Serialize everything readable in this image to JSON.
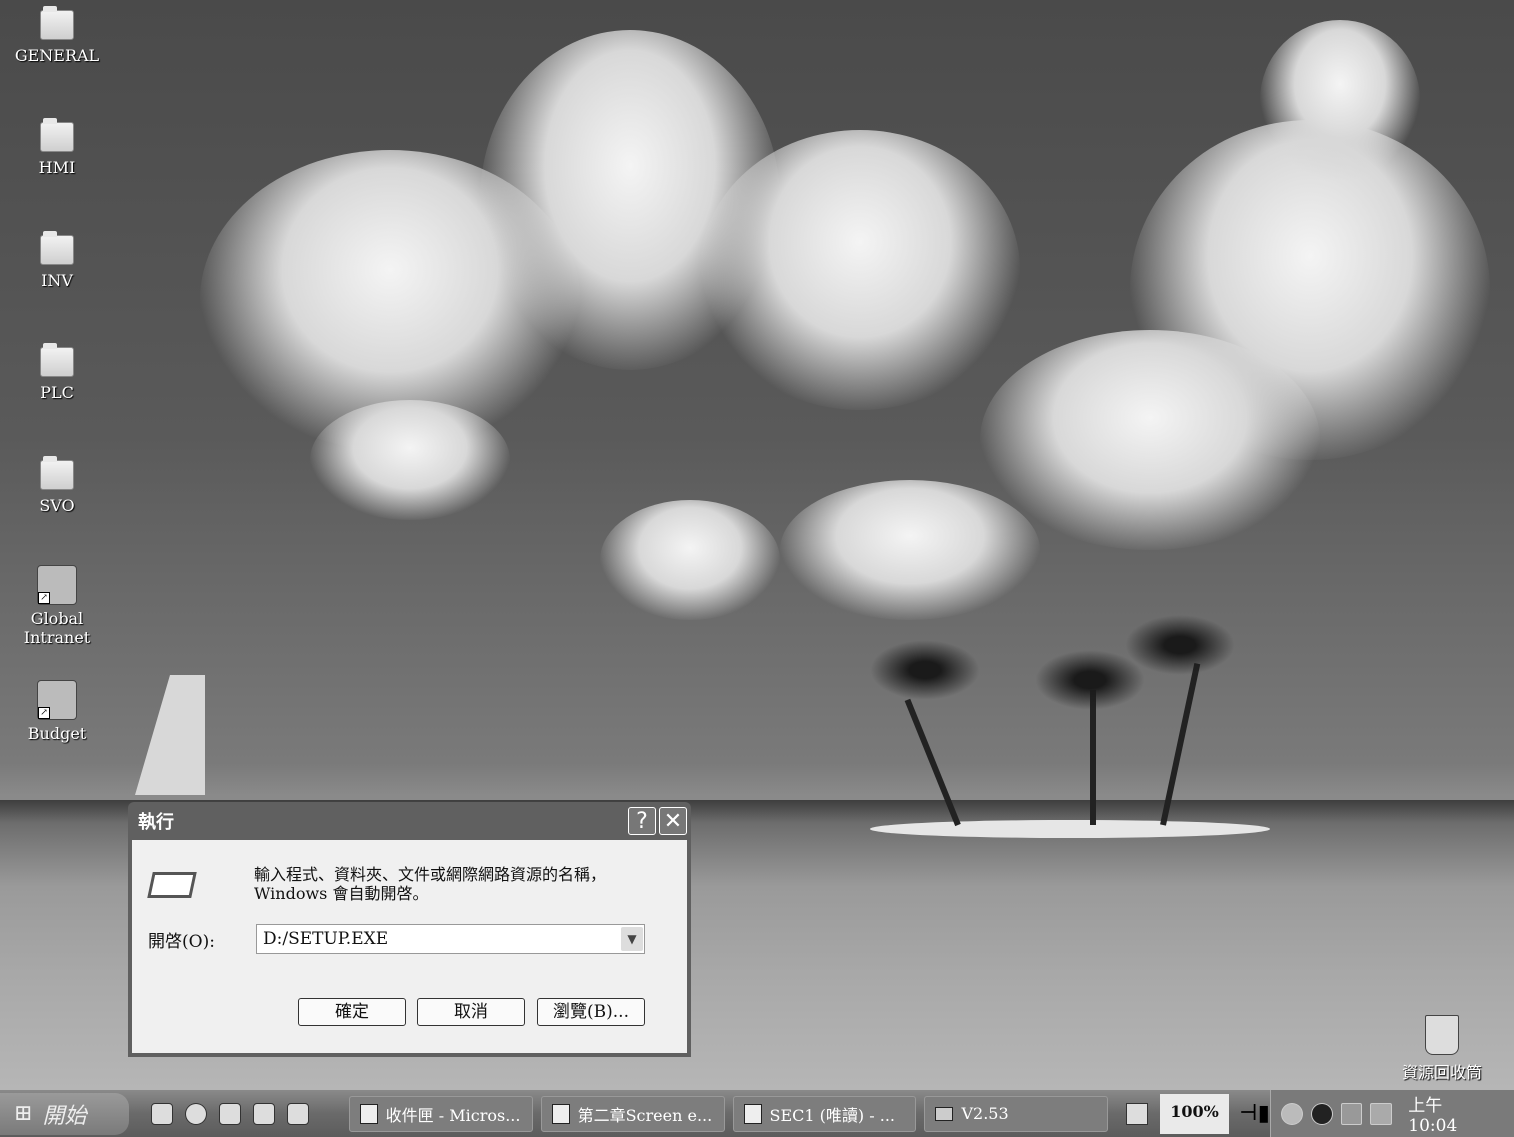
{
  "desktop": {
    "icons": [
      {
        "label": "GENERAL",
        "type": "folder"
      },
      {
        "label": "HMI",
        "type": "folder"
      },
      {
        "label": "INV",
        "type": "folder"
      },
      {
        "label": "PLC",
        "type": "folder"
      },
      {
        "label": "SVO",
        "type": "folder"
      },
      {
        "label": "Global Intranet",
        "type": "shortcut"
      },
      {
        "label": "Budget",
        "type": "shortcut"
      }
    ],
    "recycle_bin": "資源回收筒"
  },
  "dialog": {
    "title": "執行",
    "help": "?",
    "close": "✕",
    "prompt_line1": "輸入程式、資料夾、文件或網際網路資源的名稱，",
    "prompt_line2": "Windows 會自動開啓。",
    "open_label": "開啓(O):",
    "open_value": "D:/SETUP.EXE",
    "ok": "確定",
    "cancel": "取消",
    "browse": "瀏覽(B)..."
  },
  "taskbar": {
    "start": "開始",
    "tasks": [
      {
        "label": "收件匣 - Micros..."
      },
      {
        "label": "第二章Screen e..."
      },
      {
        "label": "SEC1 (唯讀) - ..."
      },
      {
        "label": "V2.53"
      }
    ],
    "battery": "100%",
    "clock": "上午 10:04"
  }
}
